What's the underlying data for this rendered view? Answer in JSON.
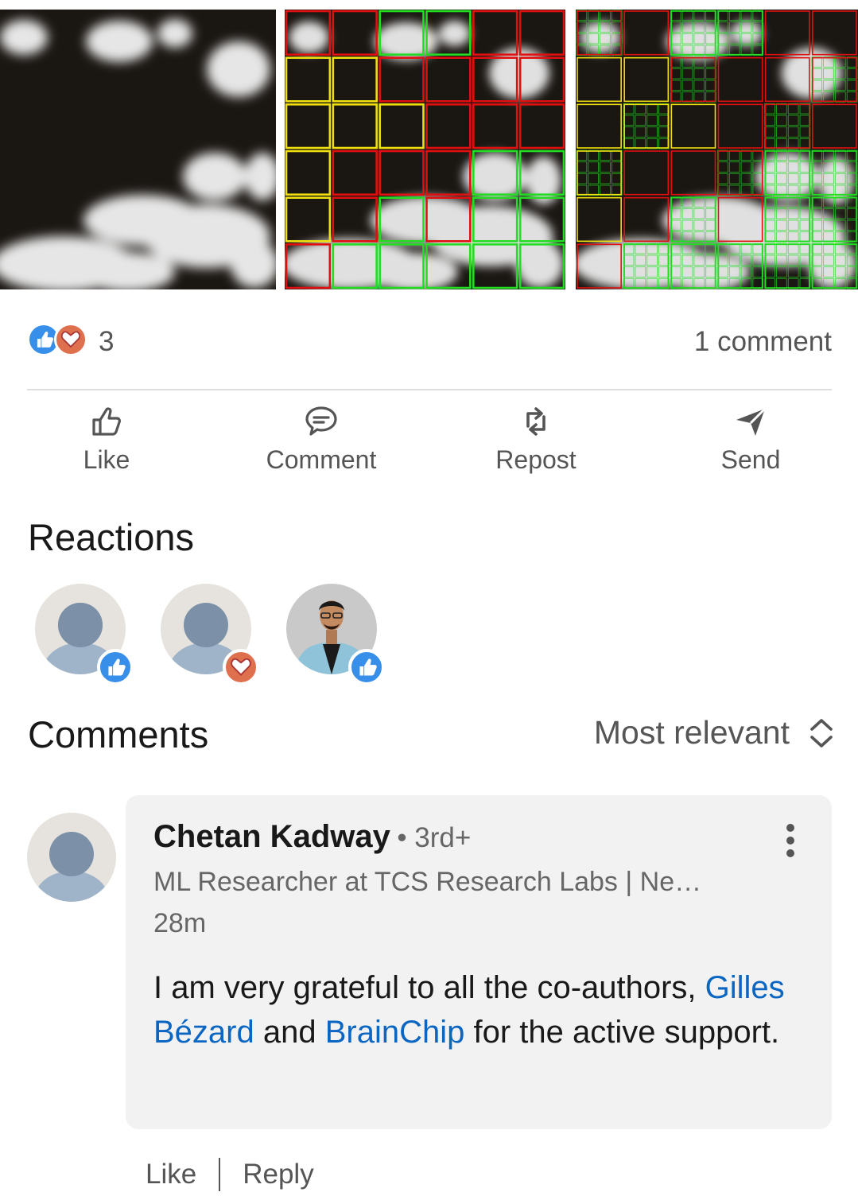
{
  "post_images": [
    {
      "name": "satellite-cloud-image"
    },
    {
      "name": "patch-classification-overlay"
    },
    {
      "name": "multi-scale-patch-overlay"
    }
  ],
  "social_counts": {
    "reaction_count": "3",
    "reaction_icons": [
      "like-icon",
      "love-icon"
    ],
    "comment_count": "1 comment"
  },
  "actions": {
    "like": "Like",
    "comment": "Comment",
    "repost": "Repost",
    "send": "Send"
  },
  "reactions": {
    "title": "Reactions",
    "reactors": [
      {
        "avatar": "default-avatar",
        "reaction": "like"
      },
      {
        "avatar": "default-avatar",
        "reaction": "love"
      },
      {
        "avatar": "profile-photo",
        "reaction": "like"
      }
    ]
  },
  "comments": {
    "title": "Comments",
    "sort_label": "Most relevant",
    "items": [
      {
        "author": "Chetan Kadway",
        "degree": "• 3rd+",
        "headline": "ML Researcher at TCS Research Labs | Ne…",
        "time": "28m",
        "text_part1": "I am very grateful to all the co-authors, ",
        "mention1": "Gilles Bézard",
        "text_part2": " and ",
        "mention2": "BrainChip",
        "text_part3": " for the active support.",
        "like_label": "Like",
        "reply_label": "Reply"
      }
    ]
  },
  "colors": {
    "like": "#378fe9",
    "love": "#df704d",
    "link": "#0a66c2",
    "grid_green": "#22dd22",
    "grid_red": "#e01010",
    "grid_yellow": "#f0e010"
  }
}
